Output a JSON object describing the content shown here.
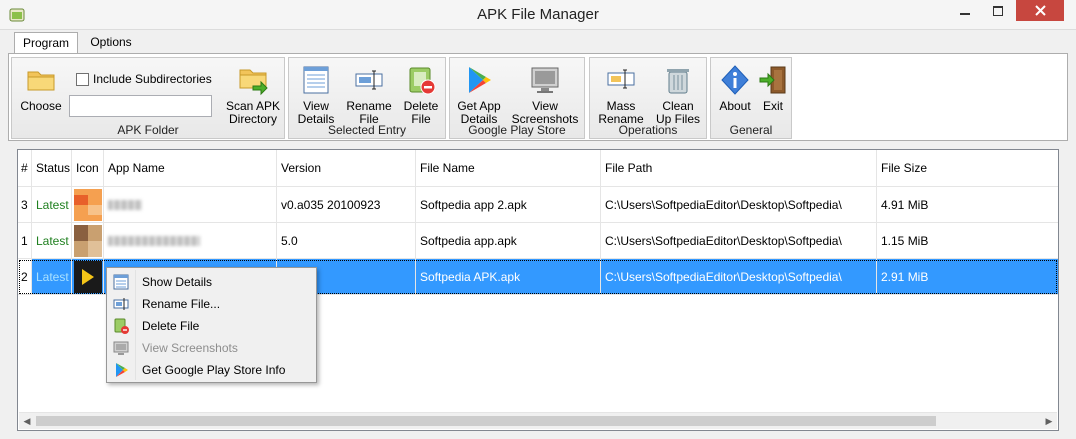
{
  "window": {
    "title": "APK File Manager"
  },
  "tabs": [
    {
      "label": "Program",
      "active": true
    },
    {
      "label": "Options",
      "active": false
    }
  ],
  "ribbon": {
    "apk_folder": {
      "label": "APK Folder",
      "choose_label": "Choose",
      "include_subdirs_label": "Include Subdirectories",
      "include_subdirs_checked": false,
      "path_value": "",
      "scan_line1": "Scan APK",
      "scan_line2": "Directory"
    },
    "selected_entry": {
      "label": "Selected Entry",
      "view_line1": "View",
      "view_line2": "Details",
      "rename_line1": "Rename",
      "rename_line2": "File",
      "delete_line1": "Delete",
      "delete_line2": "File"
    },
    "play_store": {
      "label": "Google Play Store",
      "get_line1": "Get App",
      "get_line2": "Details",
      "screens_line1": "View",
      "screens_line2": "Screenshots"
    },
    "operations": {
      "label": "Operations",
      "mass_line1": "Mass",
      "mass_line2": "Rename",
      "clean_line1": "Clean",
      "clean_line2": "Up Files"
    },
    "general": {
      "label": "General",
      "about": "About",
      "exit": "Exit"
    }
  },
  "table": {
    "columns": [
      "#",
      "Status",
      "Icon",
      "App Name",
      "Version",
      "File Name",
      "File Path",
      "File Size"
    ],
    "rows": [
      {
        "num": "3",
        "status": "Latest",
        "app_name": "",
        "version": "v0.a035 20100923",
        "file_name": "Softpedia app 2.apk",
        "file_path": "C:\\Users\\SoftpediaEditor\\Desktop\\Softpedia\\",
        "file_size": "4.91 MiB",
        "selected": false
      },
      {
        "num": "1",
        "status": "Latest",
        "app_name": "",
        "version": "5.0",
        "file_name": "Softpedia app.apk",
        "file_path": "C:\\Users\\SoftpediaEditor\\Desktop\\Softpedia\\",
        "file_size": "1.15 MiB",
        "selected": false
      },
      {
        "num": "2",
        "status": "Latest",
        "app_name": "",
        "version": "",
        "file_name": "Softpedia APK.apk",
        "file_path": "C:\\Users\\SoftpediaEditor\\Desktop\\Softpedia\\",
        "file_size": "2.91 MiB",
        "selected": true
      }
    ]
  },
  "context_menu": {
    "items": [
      {
        "label": "Show Details",
        "icon": "details-icon",
        "enabled": true
      },
      {
        "label": "Rename File...",
        "icon": "rename-icon",
        "enabled": true
      },
      {
        "label": "Delete File",
        "icon": "delete-icon",
        "enabled": true
      },
      {
        "label": "View Screenshots",
        "icon": "screenshots-icon",
        "enabled": false
      },
      {
        "label": "Get Google Play Store Info",
        "icon": "play-store-icon",
        "enabled": true
      }
    ]
  },
  "colors": {
    "selection": "#3399ff",
    "status_latest": "#208020",
    "close_button": "#c7473f"
  }
}
